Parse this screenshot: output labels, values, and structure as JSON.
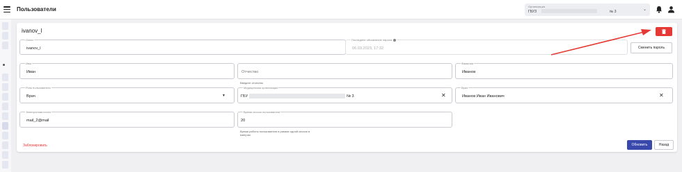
{
  "header": {
    "title": "Пользователи",
    "organization": {
      "label": "Организация",
      "value_prefix": "ГБУЗ",
      "value_suffix": "№ 3"
    }
  },
  "icons": {
    "menu": "hamburger-icon",
    "notifications": "bell-icon",
    "profile": "user-icon",
    "delete": "trash-icon",
    "clear": "close-icon",
    "dropdown": "caret-down-icon"
  },
  "colors": {
    "delete_button": "#e53935",
    "update_button": "#3949ab",
    "block_link": "#e53935",
    "annotation_arrow": "#e53935"
  },
  "user": {
    "heading": "ivanov_l"
  },
  "form": {
    "login": {
      "label": "Логин",
      "value": "ivanov_l"
    },
    "last_password_update": {
      "label": "Последнее обновление пароля",
      "value": "06.03.2023, 17:32"
    },
    "change_password_label": "Сменить пароль",
    "first_name": {
      "label": "Имя",
      "value": "Иван"
    },
    "patronymic": {
      "placeholder": "Отчество",
      "helper": "Введите отчество"
    },
    "last_name": {
      "label": "Фамилия",
      "value": "Иванов"
    },
    "role": {
      "label": "Роль пользователя",
      "value": "Врач"
    },
    "medical_org": {
      "label": "Медицинская организация",
      "value_prefix": "ГБУ",
      "value_suffix": "№ 3"
    },
    "doctor": {
      "label": "Врач",
      "value": "Иванов Иван Иванович"
    },
    "email": {
      "label": "Электронная почта",
      "value": "mail_2@mail"
    },
    "session_time": {
      "label": "Время сессии пользователя",
      "value": "20",
      "helper_line1": "Время работы пользователя в рамках одной сессии в",
      "helper_line2": "минутах"
    }
  },
  "actions": {
    "block_label": "Заблокировать",
    "update_label": "Обновить",
    "back_label": "Назад"
  }
}
